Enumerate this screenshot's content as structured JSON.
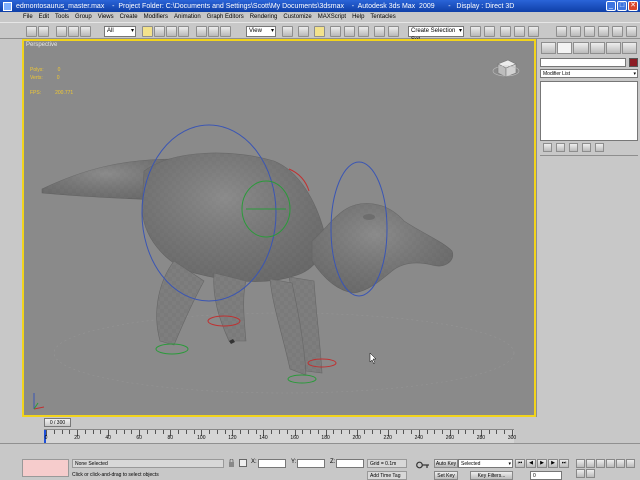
{
  "window": {
    "title": "edmontosaurus_master.max    -  Project Folder: C:\\Documents and Settings\\Scott\\My Documents\\3dsmax    -  Autodesk 3ds Max  2009       -   Display : Direct 3D",
    "buttons": [
      "_",
      "□",
      "✕"
    ]
  },
  "menu": [
    "File",
    "Edit",
    "Tools",
    "Group",
    "Views",
    "Create",
    "Modifiers",
    "Animation",
    "Graph Editors",
    "Rendering",
    "Customize",
    "MAXScript",
    "Help",
    "Tentacles"
  ],
  "toolbar": {
    "filter_dropdown": "All",
    "coord_dropdown": "View",
    "selection_set_dropdown": "Create Selection Set"
  },
  "viewport": {
    "label": "Perspective",
    "stats": {
      "polys_label": "Polys:",
      "polys_value": "0",
      "verts_label": "Verts:",
      "verts_value": "0",
      "fps_label": "FPS:",
      "fps_value": "200.771"
    }
  },
  "command_panel": {
    "modifier_list": "Modifier List"
  },
  "time_slider": {
    "label": "0 / 300"
  },
  "timeline": {
    "ticks": [
      "0",
      "20",
      "40",
      "60",
      "80",
      "100",
      "120",
      "140",
      "160",
      "180",
      "200",
      "220",
      "240",
      "260",
      "280",
      "300"
    ]
  },
  "status": {
    "selection": "None Selected",
    "prompt": "Click or click-and-drag to select objects",
    "x_label": "X:",
    "y_label": "Y:",
    "z_label": "Z:",
    "grid": "Grid = 0.1m",
    "add_time_tag": "Add Time Tag",
    "auto_key": "Auto Key",
    "set_key": "Set Key",
    "selected_dropdown": "Selected",
    "key_filters": "Key Filters...",
    "current_frame": "0"
  },
  "colors": {
    "viewport_bg": "#8a8a8a",
    "active_border": "#f2d41c",
    "stats_text": "#f0c832",
    "title_blue": "#1f52c2"
  }
}
